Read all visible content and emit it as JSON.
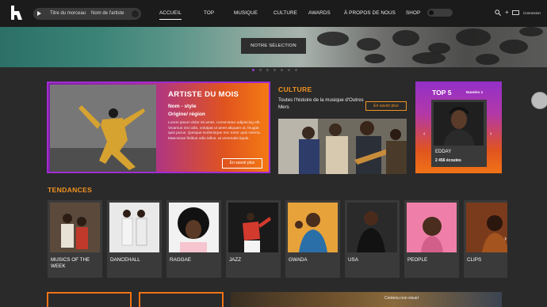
{
  "header": {
    "player": {
      "track": "Titre du morceau",
      "artist": "Nom de l'artiste"
    },
    "nav": [
      {
        "label": "ACCUEIL",
        "active": true
      },
      {
        "label": "TOP"
      },
      {
        "label": "MUSIQUE"
      },
      {
        "label": "CULTURE"
      },
      {
        "label": "AWARDS"
      },
      {
        "label": "À PROPOS DE NOUS"
      },
      {
        "label": "SHOP"
      }
    ],
    "login": "Connexion"
  },
  "hero": {
    "button": "NOTRE SÉLECTION"
  },
  "artist_of_month": {
    "title": "ARTISTE DU MOIS",
    "subtitle_1": "Nom - style",
    "subtitle_2": "Origine/ région",
    "body": "Lorem ipsum dolor sit amet, consectetur adipiscing elit. Vivamus nisi odio, volutpat ut amet aliquam ut, feugiat quis purus. Quisque scelerisque nec tortor quis viverra. Maecenas finibus odio tellus, at venenatis ligula.",
    "button": "En savoir plus"
  },
  "culture": {
    "title": "CULTURE",
    "subtitle": "Toutes l'histoire de la musique d'Outres Mers",
    "button": "En savoir plus"
  },
  "top5": {
    "title": "TOP 5",
    "rank": "Numéro 1",
    "artist": "EDDAY",
    "plays": "2 456 écoutes"
  },
  "tendances": {
    "title": "TENDANCES",
    "items": [
      {
        "label": "MUSICS OF THE WEEK"
      },
      {
        "label": "DANCEHALL"
      },
      {
        "label": "RAGGAE"
      },
      {
        "label": "JAZZ"
      },
      {
        "label": "GWADA"
      },
      {
        "label": "USA"
      },
      {
        "label": "PEOPLE"
      },
      {
        "label": "CLIPS"
      }
    ]
  },
  "bottom": {
    "teaser_text": "Contenu non visuel"
  },
  "colors": {
    "accent_orange": "#f29321",
    "accent_purple": "#9b3dd6",
    "background": "#2a2a2a"
  }
}
